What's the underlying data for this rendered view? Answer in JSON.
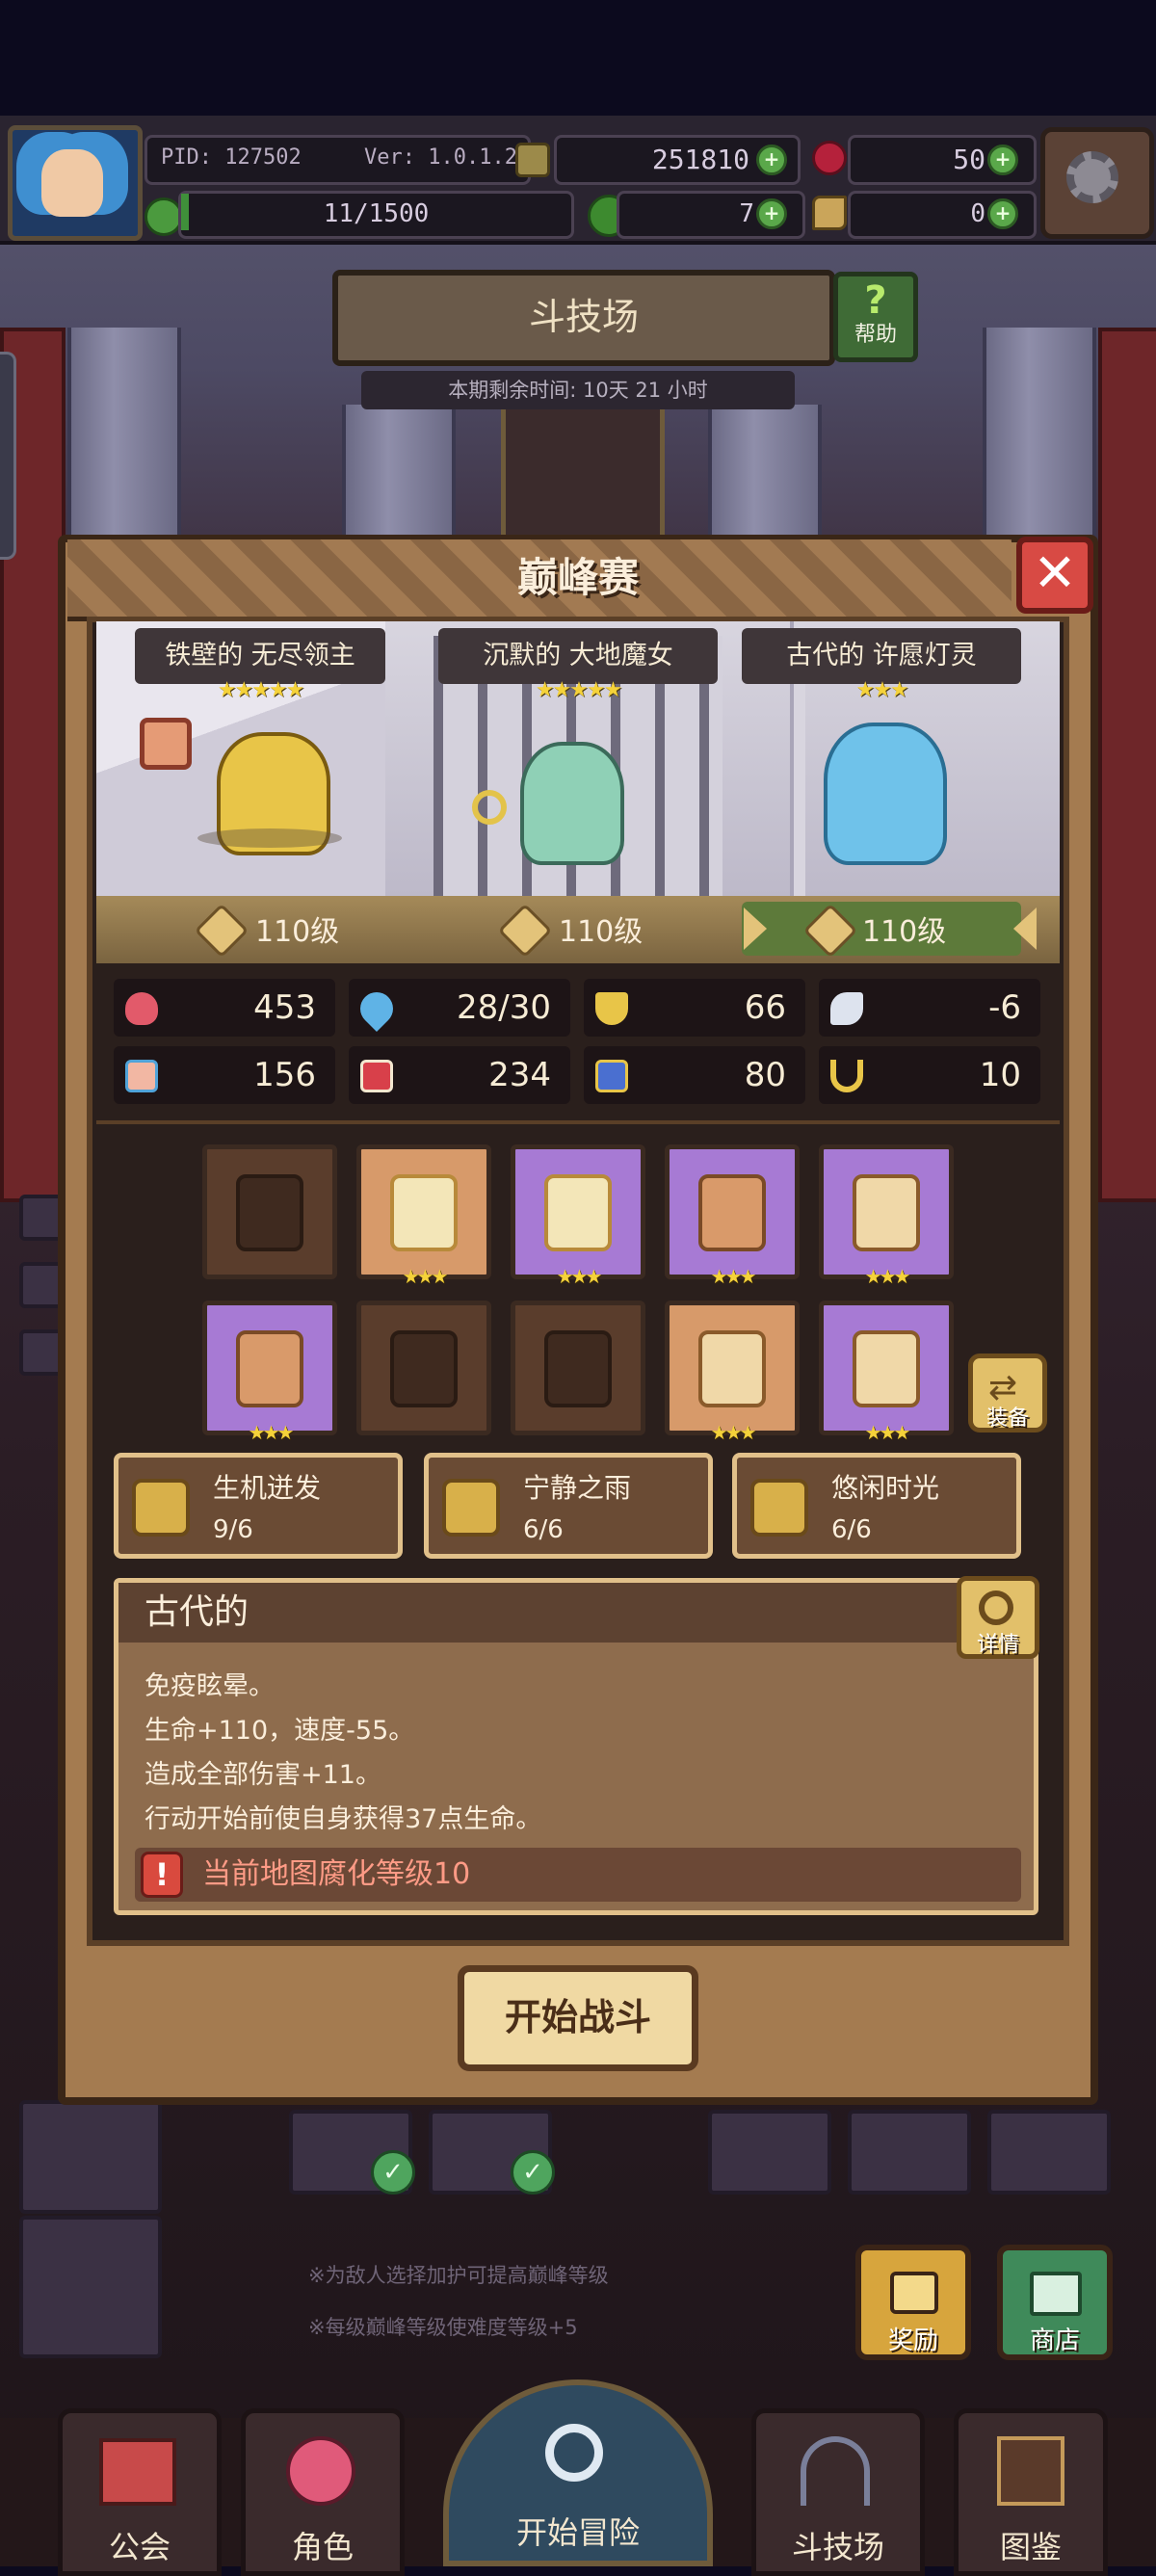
{
  "hud": {
    "pid": "PID: 127502",
    "version": "Ver: 1.0.1.2",
    "gold": "251810",
    "gems": "50",
    "energy": "11/1500",
    "clover": "7",
    "tickets": "0"
  },
  "arena": {
    "title": "斗技场",
    "help_label": "帮助",
    "remaining": "本期剩余时间: 10天 21 小时"
  },
  "modal": {
    "title": "巅峰赛",
    "close_icon": "close-icon",
    "heroes": [
      {
        "name": "铁壁的 无尽领主",
        "stars": "★★★★★",
        "level": "110级"
      },
      {
        "name": "沉默的 大地魔女",
        "stars": "★★★★★",
        "level": "110级"
      },
      {
        "name": "古代的 许愿灯灵",
        "stars": "★★★",
        "level": "110级"
      }
    ],
    "stats": [
      {
        "icon": "heart-icon",
        "value": "453"
      },
      {
        "icon": "water-drop-icon",
        "value": "28/30"
      },
      {
        "icon": "shield-icon",
        "value": "66"
      },
      {
        "icon": "wing-icon",
        "value": "-6"
      },
      {
        "icon": "fist-icon",
        "value": "156"
      },
      {
        "icon": "spellbook-icon",
        "value": "234"
      },
      {
        "icon": "boot-icon",
        "value": "80"
      },
      {
        "icon": "horseshoe-icon",
        "value": "10"
      }
    ],
    "equip_label": "装备",
    "slot_stars": "★★★",
    "sets": [
      {
        "name": "生机迸发",
        "count": "9/6"
      },
      {
        "name": "宁静之雨",
        "count": "6/6"
      },
      {
        "name": "悠闲时光",
        "count": "6/6"
      }
    ],
    "desc": {
      "title": "古代的",
      "detail_label": "详情",
      "lines": [
        "免疫眩晕。",
        "生命+110，速度-55。",
        "造成全部伤害+11。",
        "行动开始前使自身获得37点生命。"
      ],
      "warning": "当前地图腐化等级10"
    },
    "start_fight": "开始战斗"
  },
  "hints": [
    "※为敌人选择加护可提高巅峰等级",
    "※每级巅峰等级使难度等级+5"
  ],
  "side_buttons": {
    "reward": "奖励",
    "shop": "商店"
  },
  "nav": {
    "guild": "公会",
    "character": "角色",
    "adventure": "开始冒险",
    "arena": "斗技场",
    "codex": "图鉴"
  },
  "colors": {
    "accent_gold": "#f5d23a",
    "panel_brown": "#a47b50",
    "close_red": "#d84a44",
    "warning_text": "#ff9b86",
    "level_select_green": "#5d7a3a"
  }
}
